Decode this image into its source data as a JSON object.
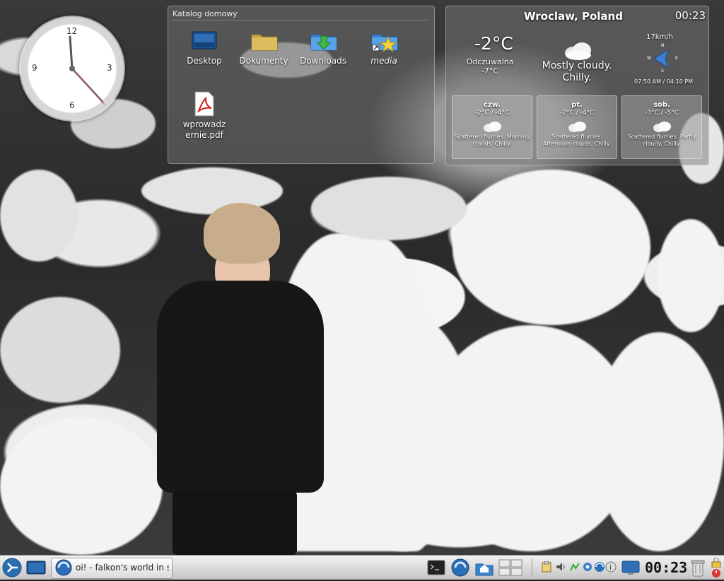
{
  "folder_view": {
    "title": "Katalog domowy",
    "items": [
      {
        "label": "Desktop",
        "icon": "desktop-icon"
      },
      {
        "label": "Dokumenty",
        "icon": "folder-icon"
      },
      {
        "label": "Downloads",
        "icon": "downloads-folder-icon"
      },
      {
        "label": "media",
        "icon": "favorites-folder-icon"
      },
      {
        "label": "wprowadz\nernie.pdf",
        "icon": "pdf-icon"
      }
    ]
  },
  "clock_widget": {
    "numbers": [
      "12",
      "3",
      "6",
      "9"
    ]
  },
  "weather": {
    "city": "Wroclaw, Poland",
    "time": "00:23",
    "temperature": "-2°C",
    "feels_like_label": "Odczuwalna",
    "feels_like_value": "-7°C",
    "condition": "Mostly cloudy. Chilly.",
    "wind_speed": "17km/h",
    "compass": {
      "n": "N",
      "e": "E",
      "s": "S",
      "w": "W"
    },
    "sunrise_sunset": "07:50 AM / 04:10 PM",
    "forecast": [
      {
        "day": "czw.",
        "temps": "-2°C / -4°C",
        "desc": "Scattered flurries. Morning clouds. Chilly."
      },
      {
        "day": "pt.",
        "temps": "-2°C / -4°C",
        "desc": "Scattered flurries. Afternoon clouds. Chilly."
      },
      {
        "day": "sob.",
        "temps": "-3°C / -5°C",
        "desc": "Scattered flurries. Partly cloudy. Chilly."
      }
    ]
  },
  "taskbar": {
    "task_label": "oi! - falkon's world in s",
    "clock": "00:23"
  },
  "colors": {
    "taskbar_bg": "#d9d9d9",
    "panel_bg": "#787878",
    "kde_blue": "#2a6fb0"
  }
}
